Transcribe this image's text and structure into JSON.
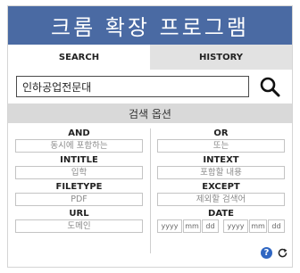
{
  "app": {
    "title": "크롬 확장 프로그램"
  },
  "tabs": [
    {
      "label": "SEARCH",
      "active": true
    },
    {
      "label": "HISTORY",
      "active": false
    }
  ],
  "search": {
    "value": "인하공업전문대",
    "button_icon": "search-icon"
  },
  "options": {
    "title": "검색 옵션",
    "left": [
      {
        "label": "AND",
        "placeholder": "동시에 포함하는"
      },
      {
        "label": "INTITLE",
        "placeholder": "입학"
      },
      {
        "label": "FILETYPE",
        "placeholder": "PDF"
      },
      {
        "label": "URL",
        "placeholder": "도메인"
      }
    ],
    "right": [
      {
        "label": "OR",
        "placeholder": "또는"
      },
      {
        "label": "INTEXT",
        "placeholder": "포함할 내용"
      },
      {
        "label": "EXCEPT",
        "placeholder": "제외할 검색어"
      }
    ],
    "date": {
      "label": "DATE",
      "from": {
        "year": "yyyy",
        "month": "mm",
        "day": "dd"
      },
      "to": {
        "year": "yyyy",
        "month": "mm",
        "day": "dd"
      }
    }
  },
  "footer": {
    "help_icon": "help-icon",
    "help_glyph": "?",
    "refresh_icon": "refresh-icon"
  },
  "colors": {
    "header_bg": "#4a6aa3",
    "options_bar_bg": "#d9d9d9",
    "inactive_tab_bg": "#e2e2e2",
    "help_icon_bg": "#2f66c2"
  }
}
